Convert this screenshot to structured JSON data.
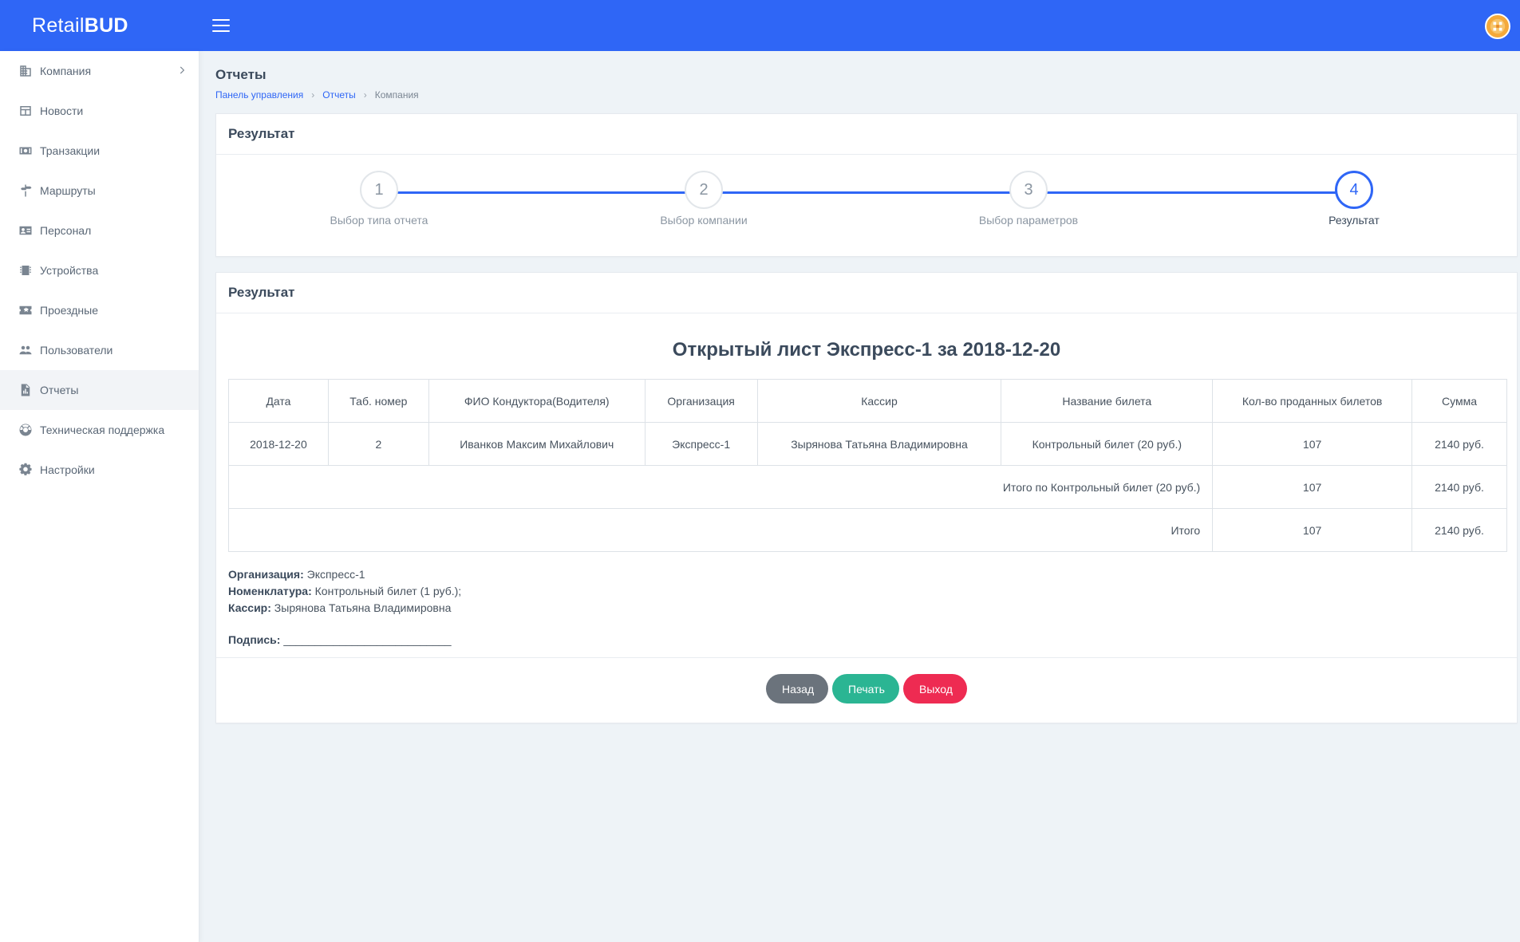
{
  "brand": {
    "part1": "Retail",
    "part2": "BUD"
  },
  "colors": {
    "primary": "#2f66f6",
    "success": "#2bb593",
    "danger": "#ee2b52",
    "secondary": "#6b737c"
  },
  "sidebar": {
    "items": [
      {
        "label": "Компания",
        "icon": "building-icon"
      },
      {
        "label": "Новости",
        "icon": "news-icon"
      },
      {
        "label": "Транзакции",
        "icon": "money-icon"
      },
      {
        "label": "Маршруты",
        "icon": "signpost-icon"
      },
      {
        "label": "Персонал",
        "icon": "id-card-icon"
      },
      {
        "label": "Устройства",
        "icon": "chip-icon"
      },
      {
        "label": "Проездные",
        "icon": "ticket-icon"
      },
      {
        "label": "Пользователи",
        "icon": "users-icon"
      },
      {
        "label": "Отчеты",
        "icon": "report-icon",
        "active": true
      },
      {
        "label": "Техническая поддержка",
        "icon": "lifebuoy-icon"
      },
      {
        "label": "Настройки",
        "icon": "gear-icon"
      }
    ]
  },
  "page": {
    "title": "Отчеты",
    "breadcrumb": [
      "Панель управления",
      "Отчеты",
      "Компания"
    ]
  },
  "wizard": {
    "header": "Результат",
    "steps": [
      {
        "number": "1",
        "label": "Выбор типа отчета"
      },
      {
        "number": "2",
        "label": "Выбор компании"
      },
      {
        "number": "3",
        "label": "Выбор параметров"
      },
      {
        "number": "4",
        "label": "Результат"
      }
    ],
    "active_step": 4
  },
  "result": {
    "header": "Результат",
    "report_title": "Открытый лист Экспресс-1 за 2018-12-20",
    "table": {
      "columns": [
        "Дата",
        "Таб. номер",
        "ФИО Кондуктора(Водителя)",
        "Организация",
        "Кассир",
        "Название билета",
        "Кол-во проданных билетов",
        "Сумма"
      ],
      "row": [
        "2018-12-20",
        "2",
        "Иванков Максим Михайлович",
        "Экспресс-1",
        "Зырянова Татьяна Владимировна",
        "Контрольный билет (20 руб.)",
        "107",
        "2140 руб."
      ],
      "subtotal": {
        "label": "Итого по Контрольный билет (20 руб.)",
        "count": "107",
        "sum": "2140 руб."
      },
      "total": {
        "label": "Итого",
        "count": "107",
        "sum": "2140 руб."
      }
    },
    "meta": {
      "org_label": "Организация:",
      "org_value": "Экспресс-1",
      "nom_label": "Номенклатура:",
      "nom_value": "Контрольный билет (1 руб.);",
      "cashier_label": "Кассир:",
      "cashier_value": "Зырянова Татьяна Владимировна",
      "sign_label": "Подпись:",
      "sign_value": "___________________________"
    },
    "buttons": {
      "back": "Назад",
      "print": "Печать",
      "exit": "Выход"
    }
  }
}
